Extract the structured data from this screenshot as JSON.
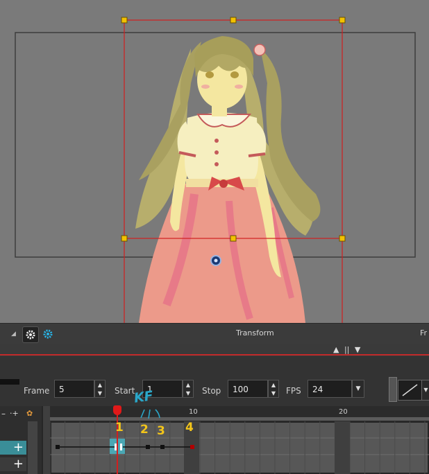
{
  "toolbar": {
    "panel_title": "Transform",
    "panel_title_right": "Fr",
    "icon_left": "gear-icon",
    "icon_right": "gear-blue-icon"
  },
  "frame_bar": {
    "frame_label": "Frame",
    "frame_value": "5",
    "start_label": "Start",
    "start_value": "1",
    "stop_label": "Stop",
    "stop_value": "100",
    "fps_label": "FPS",
    "fps_value": "24"
  },
  "ruler": {
    "tick_10": "10",
    "tick_20": "20"
  },
  "annotations": {
    "kf": "KF",
    "n1": "1",
    "n2": "2",
    "n3": "3",
    "n4": "4"
  },
  "colors": {
    "accent_red": "#d21f1f",
    "handle_yellow": "#f2c200",
    "annotation_blue": "#2aa7c9",
    "annotation_yellow": "#f3c51a",
    "selected_cell": "#4aa7b4"
  }
}
